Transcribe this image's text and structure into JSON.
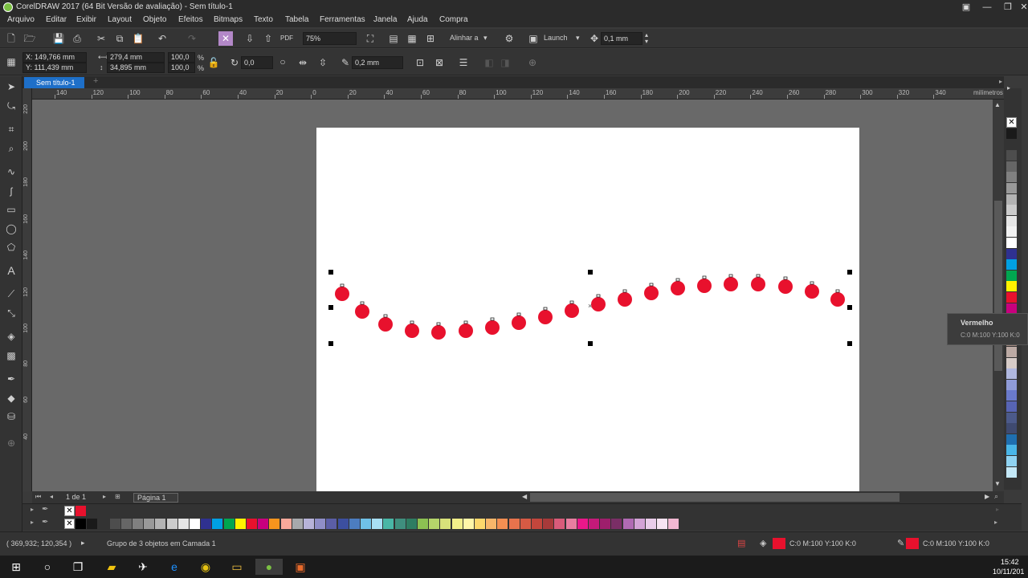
{
  "window": {
    "title": "CorelDRAW 2017 (64 Bit Versão de avaliação) - Sem título-1"
  },
  "menu": [
    "Arquivo",
    "Editar",
    "Exibir",
    "Layout",
    "Objeto",
    "Efeitos",
    "Bitmaps",
    "Texto",
    "Tabela",
    "Ferramentas",
    "Janela",
    "Ajuda",
    "Compra"
  ],
  "standard_bar": {
    "zoom": "75%",
    "align_label": "Alinhar a",
    "launch_label": "Launch",
    "nudge": "0,1 mm"
  },
  "property_bar": {
    "x": "X: 149,766 mm",
    "y": "Y: 111,439 mm",
    "width": "279,4 mm",
    "height": "34,895 mm",
    "scale_x": "100,0",
    "scale_y": "100,0",
    "percent": "%",
    "rotation": "0,0",
    "outline": "0,2 mm"
  },
  "document": {
    "tab": "Sem título-1"
  },
  "rulers": {
    "h_labels": [
      "140",
      "120",
      "100",
      "80",
      "60",
      "40",
      "20",
      "0",
      "20",
      "40",
      "60",
      "80",
      "100",
      "120",
      "140",
      "160",
      "180",
      "200",
      "220",
      "240",
      "260",
      "280",
      "300",
      "320",
      "340"
    ],
    "units": "milímetros",
    "v_labels": [
      "220",
      "200",
      "180",
      "160",
      "140",
      "120",
      "100",
      "80",
      "60",
      "40"
    ]
  },
  "palette_tooltip": {
    "name": "Vermelho",
    "cmyk": "C:0 M:100 Y:100 K:0"
  },
  "page_nav": {
    "count": "1 de 1",
    "page_tab": "Página 1"
  },
  "status": {
    "coords": "( 369,932; 120,354 )",
    "message": "Grupo de 3 objetos em Camada 1",
    "fill": "C:0 M:100 Y:100 K:0",
    "outline": "C:0 M:100 Y:100 K:0"
  },
  "taskbar": {
    "time": "15:42",
    "date": "10/11/201"
  },
  "colors": {
    "accent": "#1e6fc8",
    "fill_red": "#e8112d",
    "palette": [
      "#000000",
      "#f0f0f0",
      "#2f3190",
      "#00a0e3",
      "#00a650",
      "#fff200",
      "#e8112d"
    ]
  }
}
